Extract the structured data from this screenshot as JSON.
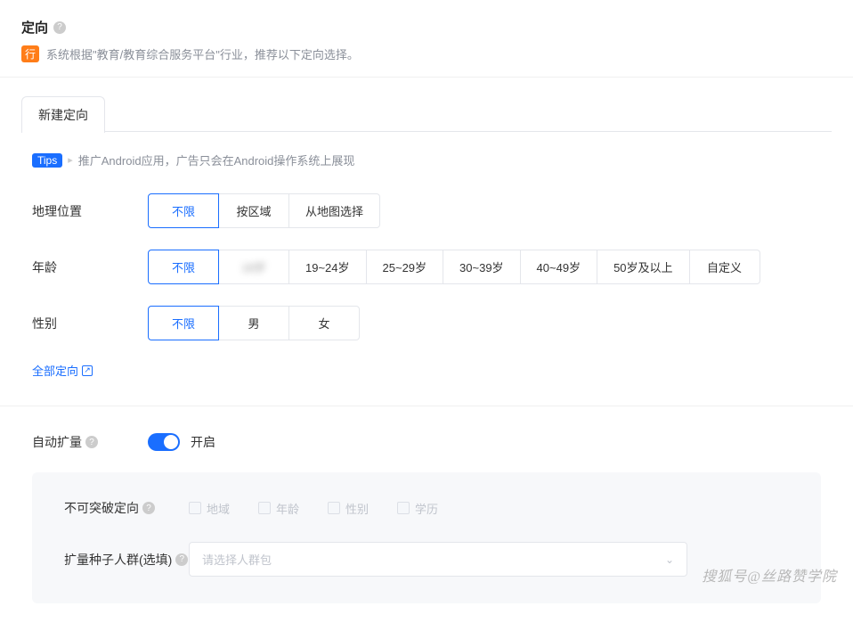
{
  "header": {
    "title": "定向",
    "badge": "行",
    "subtitle": "系统根据\"教育/教育综合服务平台\"行业，推荐以下定向选择。"
  },
  "tab": {
    "label": "新建定向"
  },
  "tips": {
    "badge": "Tips",
    "text": "推广Android应用，广告只会在Android操作系统上展现"
  },
  "location": {
    "label": "地理位置",
    "options": [
      "不限",
      "按区域",
      "从地图选择"
    ]
  },
  "age": {
    "label": "年龄",
    "options": [
      "不限",
      "18岁",
      "19~24岁",
      "25~29岁",
      "30~39岁",
      "40~49岁",
      "50岁及以上",
      "自定义"
    ]
  },
  "gender": {
    "label": "性别",
    "options": [
      "不限",
      "男",
      "女"
    ]
  },
  "all_targeting": {
    "label": "全部定向"
  },
  "auto_expand": {
    "label": "自动扩量",
    "toggle_label": "开启",
    "breakthrough": {
      "label": "不可突破定向",
      "options": [
        "地域",
        "年龄",
        "性别",
        "学历"
      ]
    },
    "seed": {
      "label": "扩量种子人群(选填)",
      "placeholder": "请选择人群包"
    }
  },
  "watermark": "搜狐号@丝路赞学院"
}
